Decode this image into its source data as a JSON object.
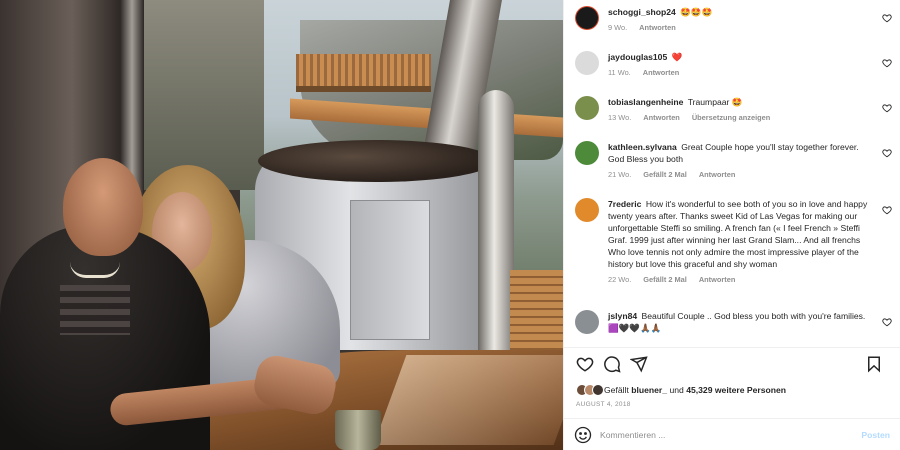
{
  "comments": [
    {
      "user": "schoggi_shop24",
      "text": "🤩🤩🤩",
      "week": "9 Wo.",
      "actions": [
        "Antworten"
      ],
      "avatar_color": "#1a1a1a",
      "ring_color": "#d94a2e"
    },
    {
      "user": "jaydouglas105",
      "text": "❤️",
      "week": "11 Wo.",
      "actions": [
        "Antworten"
      ],
      "avatar_color": "#dbdbdb",
      "ring_color": "#dbdbdb"
    },
    {
      "user": "tobiaslangenheine",
      "text": "Traumpaar 🤩",
      "week": "13 Wo.",
      "actions": [
        "Antworten",
        "Übersetzung anzeigen"
      ],
      "avatar_color": "#7a8f4c",
      "ring_color": "#7a8f4c"
    },
    {
      "user": "kathleen.sylvana",
      "text": "Great Couple hope you'll stay together forever. God Bless you both",
      "week": "21 Wo.",
      "actions": [
        "Gefällt 2 Mal",
        "Antworten"
      ],
      "avatar_color": "#4d8a3a",
      "ring_color": "#4d8a3a"
    },
    {
      "user": "7rederic",
      "text": "How it's wonderful to see both of you so in love and happy twenty years after. Thanks sweet Kid of Las Vegas for making our unforgettable Steffi so smiling. A french fan (« I feel French » Steffi Graf. 1999 just after winning her last Grand Slam... And all frenchs Who love tennis not only admire the most impressive player of the history but love this graceful and shy woman",
      "week": "22 Wo.",
      "actions": [
        "Gefällt 2 Mal",
        "Antworten"
      ],
      "avatar_color": "#e08a2c",
      "ring_color": "#e08a2c"
    },
    {
      "user": "jslyn84",
      "text": "Beautiful Couple .. God bless you both with you're families.🟪🖤🖤🙏🏾🙏🏾",
      "week": "",
      "actions": [],
      "avatar_color": "#8a8f93",
      "ring_color": "#8a8f93"
    }
  ],
  "likes": {
    "prefix": "Gefällt",
    "user": "bluener_",
    "connector": "und",
    "count": "45,329",
    "suffix": "weitere Personen"
  },
  "date": "AUGUST 4, 2018",
  "add_comment": {
    "placeholder": "Kommentieren ...",
    "post_label": "Posten"
  },
  "icons": {
    "like": "heart-icon",
    "comment": "comment-icon",
    "share": "share-icon",
    "save": "bookmark-icon",
    "emoji": "emoji-icon"
  },
  "colors": {
    "text": "#262626",
    "secondary": "#8e8e8e",
    "post_button": "#b3dbff",
    "heart_red": "#ed4956"
  }
}
